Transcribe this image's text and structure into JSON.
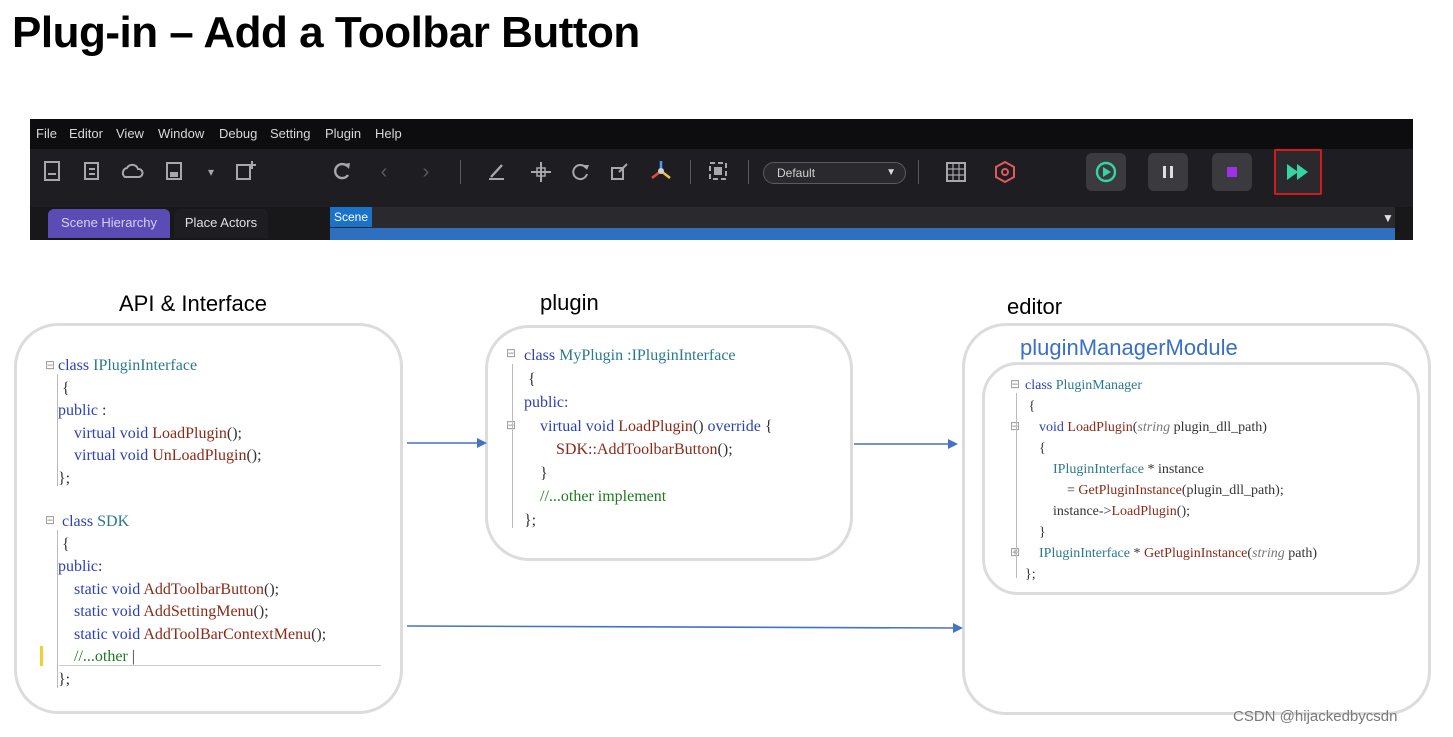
{
  "slide": {
    "title": "Plug-in – Add a Toolbar Button"
  },
  "editor": {
    "menu": [
      "File",
      "Editor",
      "View",
      "Window",
      "Debug",
      "Setting",
      "Plugin",
      "Help"
    ],
    "layout_select_value": "Default",
    "tabs": [
      "Scene Hierarchy",
      "Place Actors",
      "Scene"
    ],
    "highlighted_button": "fast-forward-play",
    "highlight_color": "#d21b1b",
    "play_color": "#36d3a3",
    "stop_color": "#9b31e8",
    "tab_accent": "#5b4bb4",
    "scene_tab_color": "#1a73c8"
  },
  "diagram": {
    "api_header": "API & Interface",
    "plugin_header": "plugin",
    "editor_header": "editor",
    "module_header": "pluginManagerModule",
    "api_code": {
      "iface_class": "class",
      "iface_name": "IPluginInterface",
      "open": "{",
      "public": "public",
      "public_colon": " :",
      "l1_kw": "virtual void ",
      "l1_fn": "LoadPlugin",
      "l1_end": "();",
      "l2_kw": "virtual void ",
      "l2_fn": "UnLoadPlugin",
      "l2_end": "();",
      "close": "};",
      "sdk_class": "class",
      "sdk_name": "SDK",
      "sdk_open": "{",
      "sdk_public": "public",
      "sdk_public_colon": ":",
      "s1_kw": "static void ",
      "s1_fn": "AddToolbarButton",
      "s1_end": "();",
      "s2_kw": "static void ",
      "s2_fn": "AddSettingMenu",
      "s2_end": "();",
      "s3_kw": "static void ",
      "s3_fn": "AddToolBarContextMenu",
      "s3_end": "();",
      "s4_cm": "//...other",
      "sdk_close": "};"
    },
    "plugin_code": {
      "class_kw": "class",
      "class_name": "MyPlugin :IPluginInterface",
      "open": "{",
      "public": "public:",
      "m_kw": "virtual void ",
      "m_fn": "LoadPlugin",
      "m_mid": "() ",
      "m_over": "override",
      "m_brace": " {",
      "call": "SDK::AddToolbarButton",
      "call_end": "();",
      "inner_close": "}",
      "other": "//...other implement",
      "close": "};"
    },
    "manager_code": {
      "class_kw": "class",
      "class_name": "PluginManager",
      "open": "{",
      "m_kw": "void ",
      "m_fn": "LoadPlugin",
      "m_paren": "(",
      "m_type": "string",
      "m_param": " plugin_dll_path)",
      "m_open": "{",
      "l1_type": "IPluginInterface",
      "l1_rest": " * instance",
      "l2_eq": "= ",
      "l2_fn": "GetPluginInstance",
      "l2_rest": "(plugin_dll_path);",
      "l3_a": "instance->",
      "l3_fn": "LoadPlugin",
      "l3_end": "();",
      "m_close": "}",
      "g_type": "IPluginInterface",
      "g_star": " * ",
      "g_fn": "GetPluginInstance",
      "g_paren": "(",
      "g_ptype": "string",
      "g_param": " path)",
      "close": "};"
    }
  },
  "footer": {
    "credit": "CSDN @hijackedbycsdn"
  }
}
